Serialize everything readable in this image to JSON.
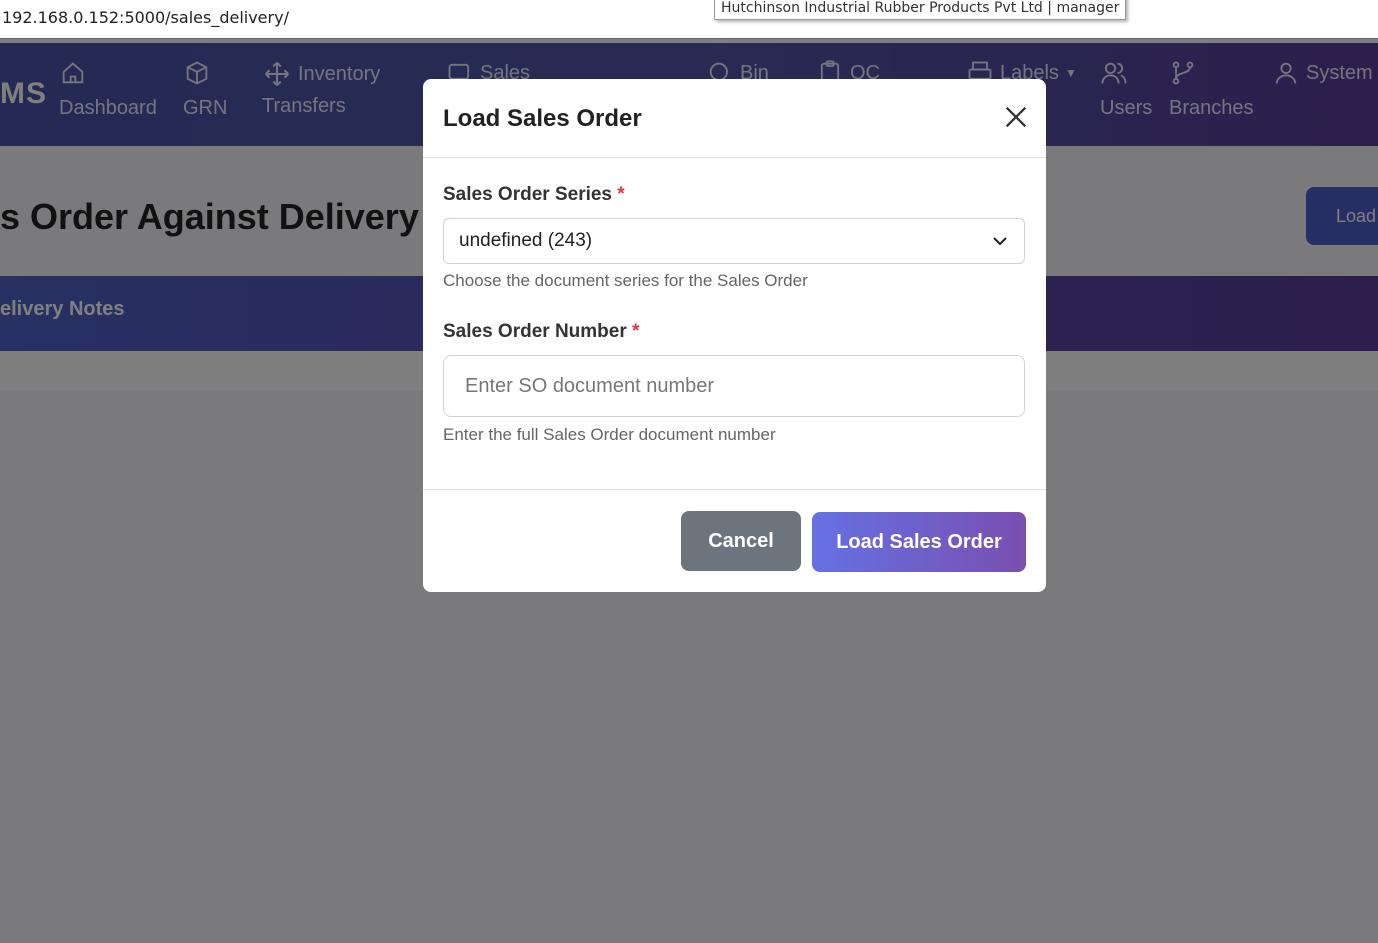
{
  "browser": {
    "url": "192.168.0.152:5000/sales_delivery/",
    "tooltip": "Hutchinson Industrial Rubber Products Pvt Ltd | manager"
  },
  "nav": {
    "brand": "MS",
    "items": [
      {
        "label": "Dashboard",
        "icon": "home-icon"
      },
      {
        "label": "GRN",
        "icon": "box-icon"
      },
      {
        "label": "Inventory",
        "label2": "Transfers",
        "icon": "move-icon"
      },
      {
        "label": "Sales",
        "icon": "cart-icon"
      },
      {
        "label": "Bin",
        "icon": "search-icon"
      },
      {
        "label": "QC",
        "icon": "clipboard-icon"
      },
      {
        "label": "Labels",
        "icon": "printer-icon"
      },
      {
        "label": "Users",
        "icon": "users-icon"
      },
      {
        "label": "Branches",
        "icon": "branch-icon"
      },
      {
        "label": "System",
        "icon": "user-icon"
      }
    ]
  },
  "page": {
    "title": "s Order Against Delivery",
    "load_button": "Load",
    "band_text": "elivery Notes"
  },
  "modal": {
    "title": "Load Sales Order",
    "series_label": "Sales Order Series",
    "required_mark": "*",
    "series_value": "undefined (243)",
    "series_help": "Choose the document series for the Sales Order",
    "number_label": "Sales Order Number",
    "number_placeholder": "Enter SO document number",
    "number_help": "Enter the full Sales Order document number",
    "cancel_label": "Cancel",
    "submit_label": "Load Sales Order"
  },
  "colors": {
    "nav_start": "#4a55a8",
    "nav_end": "#5a3d9a",
    "cancel": "#6c757d",
    "primary_start": "#6571e3",
    "primary_end": "#7a4fb0",
    "required": "#dc3545"
  }
}
